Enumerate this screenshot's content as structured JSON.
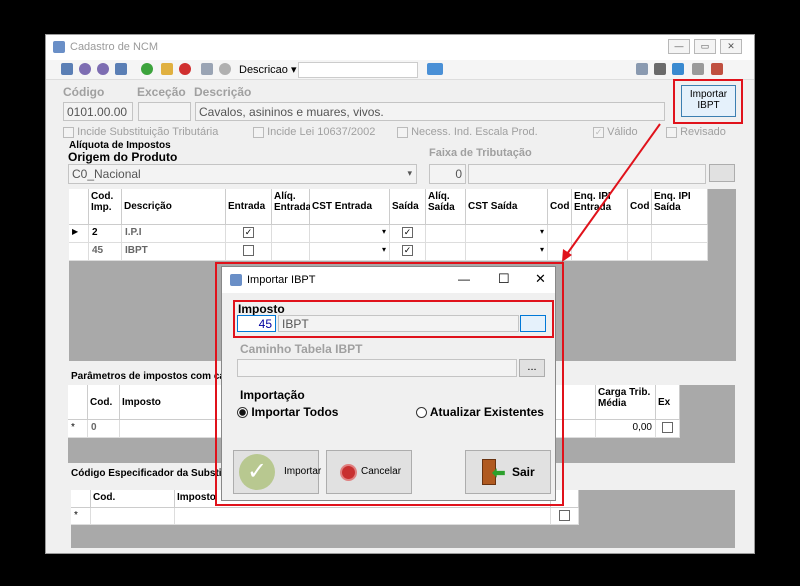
{
  "window": {
    "title": "Cadastro de NCM",
    "min_glyph": "—",
    "max_glyph": "▭",
    "close_glyph": "✕"
  },
  "toolbar": {
    "search_field": "Descricao",
    "search_value": ""
  },
  "form": {
    "codigo_label": "Código",
    "excecao_label": "Exceção",
    "descricao_label": "Descrição",
    "codigo": "0101.00.00",
    "excecao": "",
    "descricao": "Cavalos, asininos e muares, vivos.",
    "btn_importar_ibpt": "Importar IBPT",
    "chk_incide_subst": "Incide Substituição Tributária",
    "chk_incide_lei": "Incide Lei 10637/2002",
    "chk_necess": "Necess. Ind. Escala Prod.",
    "chk_valido": "Válido",
    "chk_revisado": "Revisado",
    "aliquota_group": "Alíquota de Impostos",
    "origem_label": "Origem do Produto",
    "origem_value": "C0_Nacional",
    "faixa_label": "Faixa de Tributação",
    "faixa_value": "0"
  },
  "impostos_grid": {
    "headers": [
      "Cod. Imp.",
      "Descrição",
      "Entrada",
      "Alíq. Entrada",
      "CST Entrada",
      "Saída",
      "Alíq. Saída",
      "CST Saída",
      "Cod",
      "Enq. IPI Entrada",
      "Cod",
      "Enq. IPI Saída"
    ],
    "rows": [
      {
        "cod": "2",
        "desc": "I.P.I",
        "entrada": true,
        "saida": true
      },
      {
        "cod": "45",
        "desc": "IBPT",
        "entrada": false,
        "saida": true
      }
    ]
  },
  "parametros": {
    "group": "Parâmetros de impostos com cálc",
    "headers": [
      "Cod.",
      "Imposto",
      "Carga Trib. Média",
      "Ex"
    ],
    "row": {
      "cod": "0",
      "carga": "0,00"
    }
  },
  "especificador": {
    "group": "Código Especificador da Substitu",
    "headers": [
      "Cod.",
      "Imposto"
    ]
  },
  "dialog": {
    "title": "Importar IBPT",
    "imposto_label": "Imposto",
    "imposto_cod": "45",
    "imposto_desc": "IBPT",
    "caminho_label": "Caminho Tabela IBPT",
    "browse": "...",
    "importacao_label": "Importação",
    "radio_todos": "Importar Todos",
    "radio_existentes": "Atualizar Existentes",
    "btn_importar": "Importar",
    "btn_cancelar": "Cancelar",
    "btn_sair": "Sair",
    "min_glyph": "—",
    "max_glyph": "☐",
    "close_glyph": "✕"
  },
  "colors": {
    "highlight": "#e0121b",
    "selection": "#0078d7"
  }
}
